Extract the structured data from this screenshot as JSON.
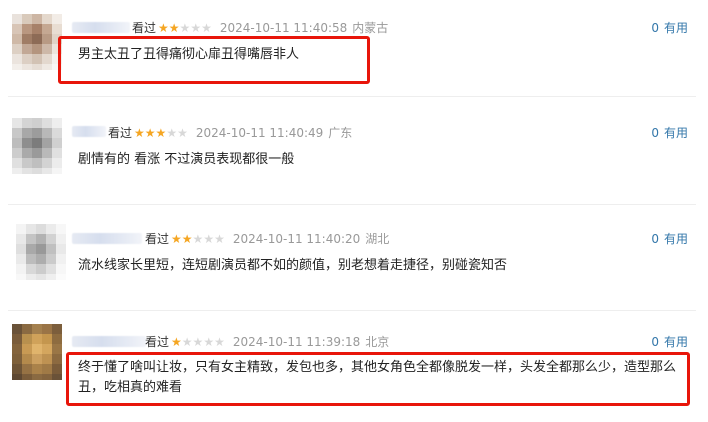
{
  "comments": [
    {
      "watched": "看过",
      "stars_on": 2,
      "stars_total": 5,
      "time": "2024-10-11 11:40:58",
      "location": "内蒙古",
      "useful_count": "0",
      "useful_label": "有用",
      "text": "男主太丑了丑得痛彻心扉丑得嘴唇非人",
      "highlighted": true
    },
    {
      "watched": "看过",
      "stars_on": 3,
      "stars_total": 5,
      "time": "2024-10-11 11:40:49",
      "location": "广东",
      "useful_count": "0",
      "useful_label": "有用",
      "text": "剧情有的 看涨 不过演员表现都很一般",
      "highlighted": false
    },
    {
      "watched": "看过",
      "stars_on": 2,
      "stars_total": 5,
      "time": "2024-10-11 11:40:20",
      "location": "湖北",
      "useful_count": "0",
      "useful_label": "有用",
      "text": "流水线家长里短，连短剧演员都不如的颜值，别老想着走捷径，别碰瓷知否",
      "highlighted": false
    },
    {
      "watched": "看过",
      "stars_on": 1,
      "stars_total": 5,
      "time": "2024-10-11 11:39:18",
      "location": "北京",
      "useful_count": "0",
      "useful_label": "有用",
      "text_line1": "终于懂了啥叫让妆，只有女主精致，发包也多，其他女角色全都像脱发一样，头发全都那么少，造型那么",
      "text_line2": "丑，吃相真的难看",
      "highlighted": true
    }
  ],
  "colors": {
    "highlight_border": "#e8150a",
    "star_on": "#f5a623",
    "star_off": "#d8d8d8",
    "useful_link": "#3377aa"
  },
  "icons": {
    "star": "star-icon",
    "avatar": "avatar-image"
  }
}
